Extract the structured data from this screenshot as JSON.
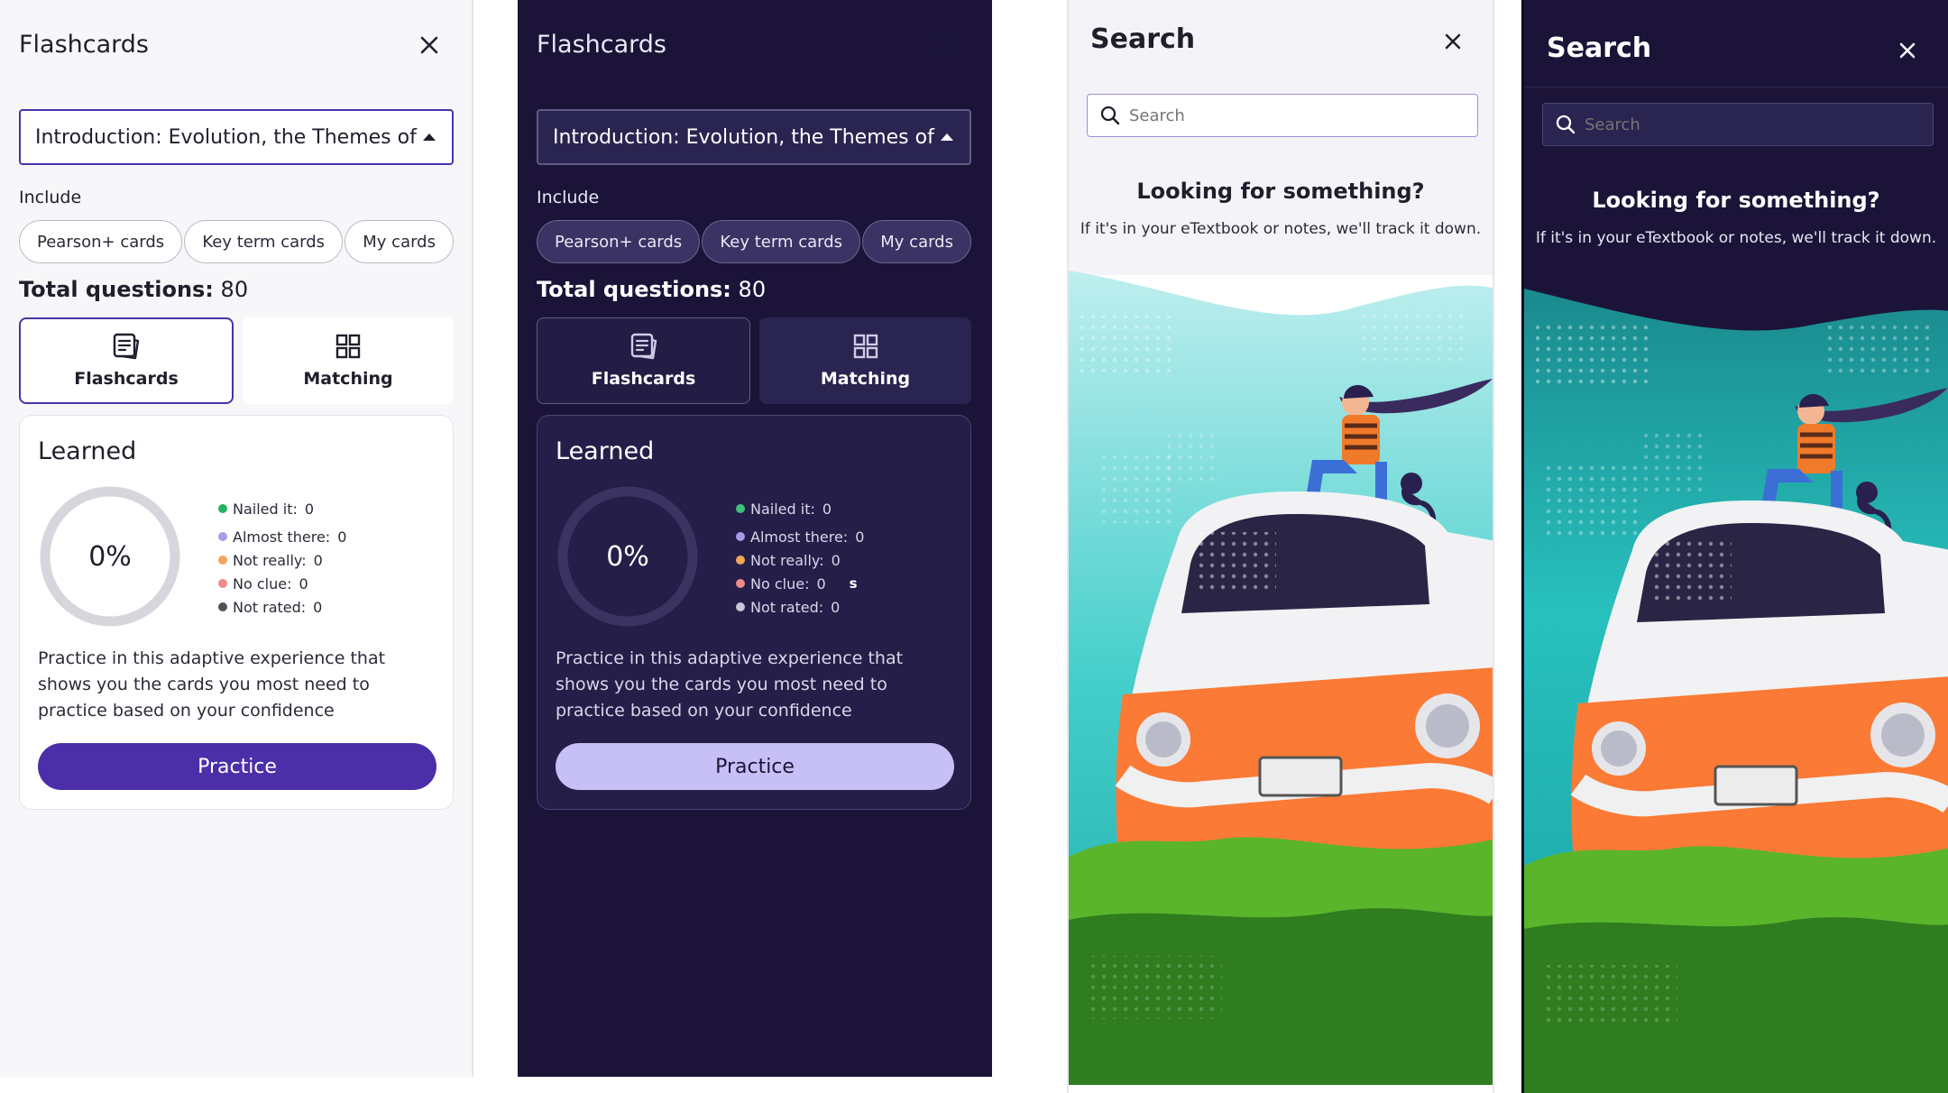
{
  "flashcards_light": {
    "title": "Flashcards",
    "chapter": "Introduction: Evolution, the Themes of",
    "include_label": "Include",
    "chips": [
      "Pearson+ cards",
      "Key term cards",
      "My cards"
    ],
    "total_label": "Total questions:",
    "total_value": "80",
    "modes": {
      "flashcards": "Flashcards",
      "matching": "Matching"
    },
    "learned_title": "Learned",
    "percent": "0%",
    "progress": 0,
    "legend": [
      {
        "label": "Nailed it:",
        "value": "0",
        "color": "#22b35e"
      },
      {
        "label": "Almost there:",
        "value": "0",
        "color": "#a89bea"
      },
      {
        "label": "Not really:",
        "value": "0",
        "color": "#f2a65a"
      },
      {
        "label": "No clue:",
        "value": "0",
        "color": "#f08a8a"
      },
      {
        "label": "Not rated:",
        "value": "0",
        "color": "#505056"
      }
    ],
    "description": "Practice in this adaptive experience that shows you the cards you most need to practice based on your confidence",
    "practice": "Practice"
  },
  "flashcards_dark": {
    "title": "Flashcards",
    "chapter": "Introduction: Evolution, the Themes of",
    "include_label": "Include",
    "chips": [
      "Pearson+ cards",
      "Key term cards",
      "My cards"
    ],
    "total_label": "Total questions:",
    "total_value": "80",
    "modes": {
      "flashcards": "Flashcards",
      "matching": "Matching"
    },
    "learned_title": "Learned",
    "percent": "0%",
    "progress": 0,
    "legend": [
      {
        "label": "Nailed it:",
        "value": "0",
        "color": "#3fc27a"
      },
      {
        "label": "Almost there:",
        "value": "0",
        "color": "#a89bea"
      },
      {
        "label": "Not really:",
        "value": "0",
        "color": "#f2a65a"
      },
      {
        "label": "No clue:",
        "value": "0",
        "color": "#f08a8a"
      },
      {
        "label": "Not rated:",
        "value": "0",
        "color": "#c9c6d6"
      }
    ],
    "stray_text": "s",
    "description": "Practice in this adaptive experience that shows you the cards you most need to practice based on your confidence",
    "practice": "Practice"
  },
  "search_light": {
    "title": "Search",
    "placeholder": "Search",
    "heading": "Looking for something?",
    "subtext": "If it's in your eTextbook or notes, we'll track it down."
  },
  "search_dark": {
    "title": "Search",
    "placeholder": "Search",
    "heading": "Looking for something?",
    "subtext": "If it's in your eTextbook or notes, we'll track it down."
  },
  "colors": {
    "brand_purple": "#4b2fa8",
    "dark_bg": "#1b1438",
    "practice_dark": "#c7c0f7",
    "van_orange": "#fb7a35",
    "teal": "#3fc9c7",
    "grass": "#5ab52a"
  }
}
